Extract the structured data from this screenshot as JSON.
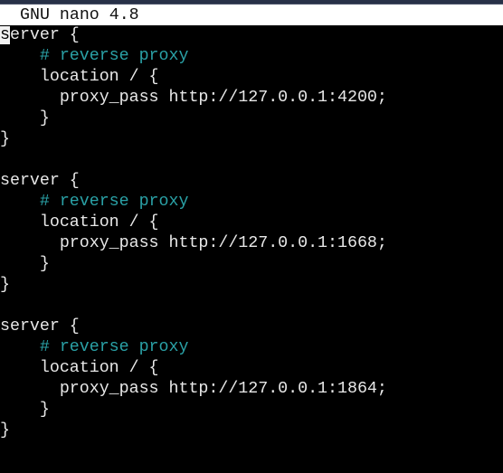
{
  "window": {
    "title": "GNU nano 4.8"
  },
  "editor": {
    "cursor": {
      "line": 1,
      "column": 1
    },
    "colors": {
      "text": "#e8e8e8",
      "comment": "#2aa1a6",
      "background": "#000000",
      "titlebar": "#ffffff"
    },
    "lines": [
      {
        "text": "server {",
        "type": "code"
      },
      {
        "text": "    # reverse proxy",
        "type": "comment"
      },
      {
        "text": "    location / {",
        "type": "code"
      },
      {
        "text": "      proxy_pass http://127.0.0.1:4200;",
        "type": "code"
      },
      {
        "text": "    }",
        "type": "code"
      },
      {
        "text": "}",
        "type": "code"
      },
      {
        "text": "",
        "type": "code"
      },
      {
        "text": "server {",
        "type": "code"
      },
      {
        "text": "    # reverse proxy",
        "type": "comment"
      },
      {
        "text": "    location / {",
        "type": "code"
      },
      {
        "text": "      proxy_pass http://127.0.0.1:1668;",
        "type": "code"
      },
      {
        "text": "    }",
        "type": "code"
      },
      {
        "text": "}",
        "type": "code"
      },
      {
        "text": "",
        "type": "code"
      },
      {
        "text": "server {",
        "type": "code"
      },
      {
        "text": "    # reverse proxy",
        "type": "comment"
      },
      {
        "text": "    location / {",
        "type": "code"
      },
      {
        "text": "      proxy_pass http://127.0.0.1:1864;",
        "type": "code"
      },
      {
        "text": "    }",
        "type": "code"
      },
      {
        "text": "}",
        "type": "code"
      }
    ],
    "first_line_cursor_char": "s",
    "first_line_rest": "erver {"
  }
}
